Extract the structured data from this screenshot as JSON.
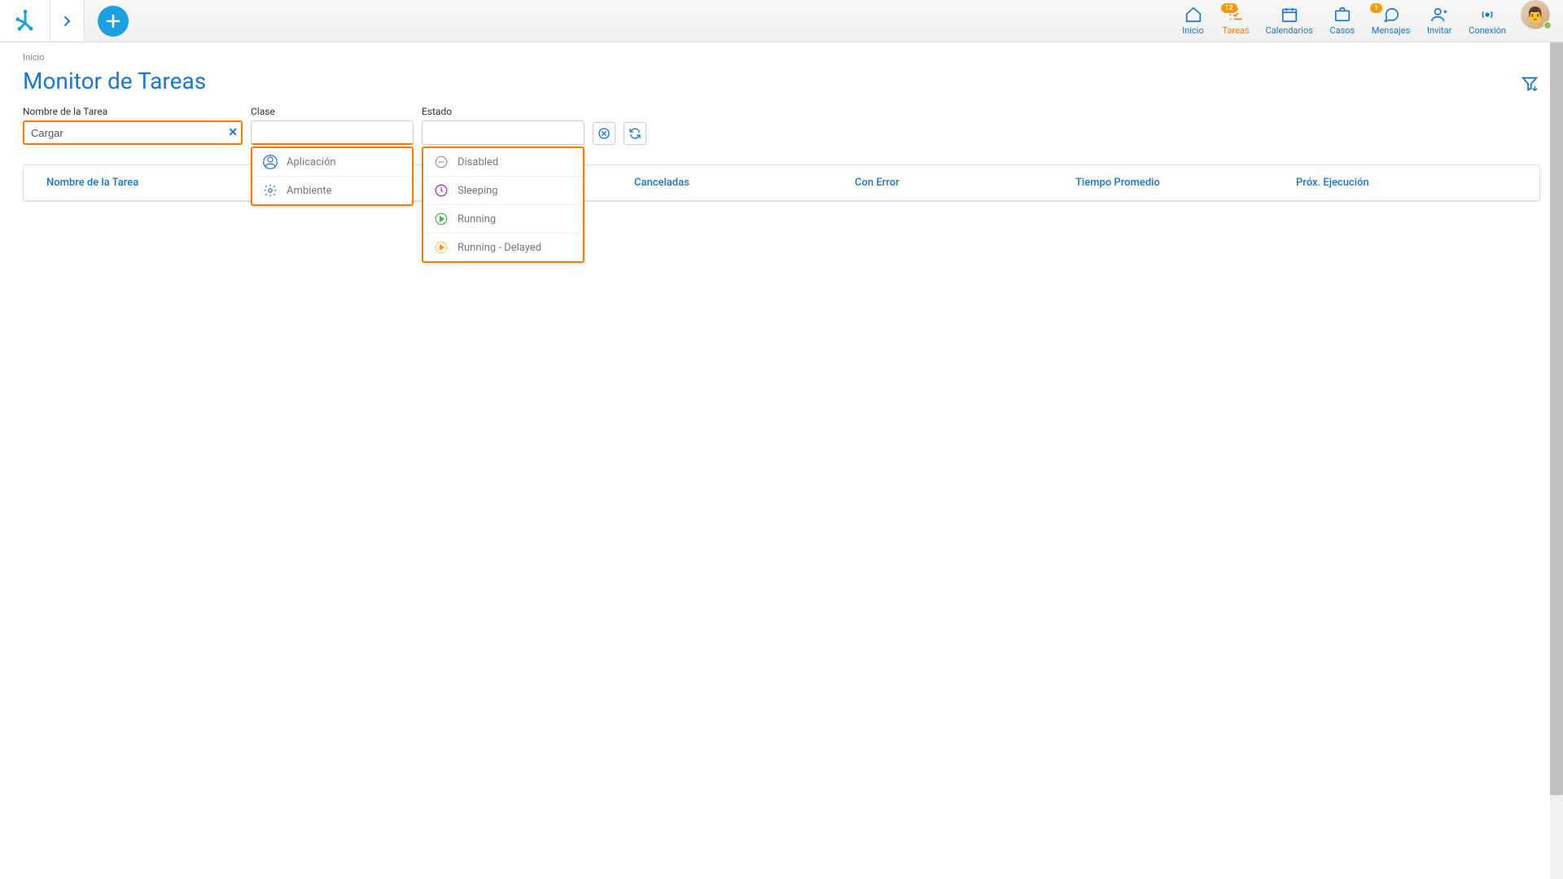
{
  "breadcrumb": "Inicio",
  "page_title": "Monitor de Tareas",
  "nav": {
    "inicio": "Inicio",
    "tareas": "Tareas",
    "tareas_badge": "12",
    "calendarios": "Calendarios",
    "casos": "Casos",
    "mensajes": "Mensajes",
    "mensajes_badge": "1",
    "invitar": "Invitar",
    "conexion": "Conexión"
  },
  "filters": {
    "nombre_label": "Nombre de la Tarea",
    "nombre_value": "Cargar",
    "clase_label": "Clase",
    "clase_value": "",
    "estado_label": "Estado",
    "estado_value": ""
  },
  "clase_options": [
    {
      "label": "Aplicación",
      "icon": "user"
    },
    {
      "label": "Ambiente",
      "icon": "gear"
    }
  ],
  "estado_options": [
    {
      "label": "Disabled",
      "color": "#999"
    },
    {
      "label": "Sleeping",
      "color": "#9C27B0"
    },
    {
      "label": "Running",
      "color": "#4CAF50"
    },
    {
      "label": "Running - Delayed",
      "color": "#FF9800"
    }
  ],
  "table": {
    "headers": [
      "Nombre de la Tarea",
      "Canceladas",
      "Con Error",
      "Tiempo Promedio",
      "Próx. Ejecución"
    ]
  }
}
